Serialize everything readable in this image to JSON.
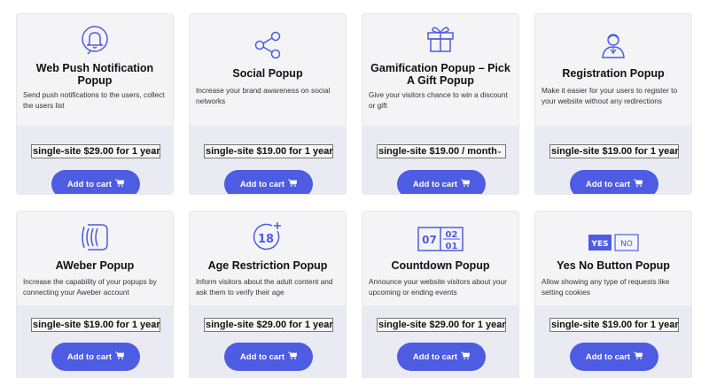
{
  "products": [
    {
      "title": "Web Push Notification Popup",
      "desc": "Send push notifications to the users, collect the users list",
      "price": "single-site $29.00 for 1 year",
      "icon": "bell-icon"
    },
    {
      "title": "Social Popup",
      "desc": "Increase your brand awareness on social networks",
      "price": "single-site $19.00 for 1 year",
      "icon": "share-icon"
    },
    {
      "title": "Gamification Popup – Pick A Gift Popup",
      "desc": "Give your visitors chance to win a discount or gift",
      "price": "single-site $19.00 / month",
      "icon": "gift-icon"
    },
    {
      "title": "Registration Popup",
      "desc": "Make it easier for your users to register to your website without any redirections",
      "price": "single-site $19.00 for 1 year",
      "icon": "user-icon"
    },
    {
      "title": "AWeber Popup",
      "desc": "Increase the capability of your popups by connecting your Aweber account",
      "price": "single-site $19.00 for 1 year",
      "icon": "aweber-icon"
    },
    {
      "title": "Age Restriction Popup",
      "desc": "Inform visitors about the adult content and ask them to verify their age",
      "price": "single-site $29.00 for 1 year",
      "icon": "age-18-icon"
    },
    {
      "title": "Countdown Popup",
      "desc": "Announce your website visitors about your upcoming or ending events",
      "price": "single-site $29.00 for 1 year",
      "icon": "countdown-icon"
    },
    {
      "title": "Yes No Button Popup",
      "desc": "Allow showing any type of requests like setting cookies",
      "price": "single-site $19.00 for 1 year",
      "icon": "yes-no-icon"
    }
  ],
  "button_label": "Add to cart",
  "countdown": {
    "left": "07",
    "right_top": "02",
    "right_bottom": "01"
  },
  "yesno": {
    "yes": "YES",
    "no": "NO"
  },
  "age_label": "18",
  "colors": {
    "accent": "#4e5be3",
    "card_top": "#f4f4f6",
    "card_bottom": "#eaebf2"
  }
}
